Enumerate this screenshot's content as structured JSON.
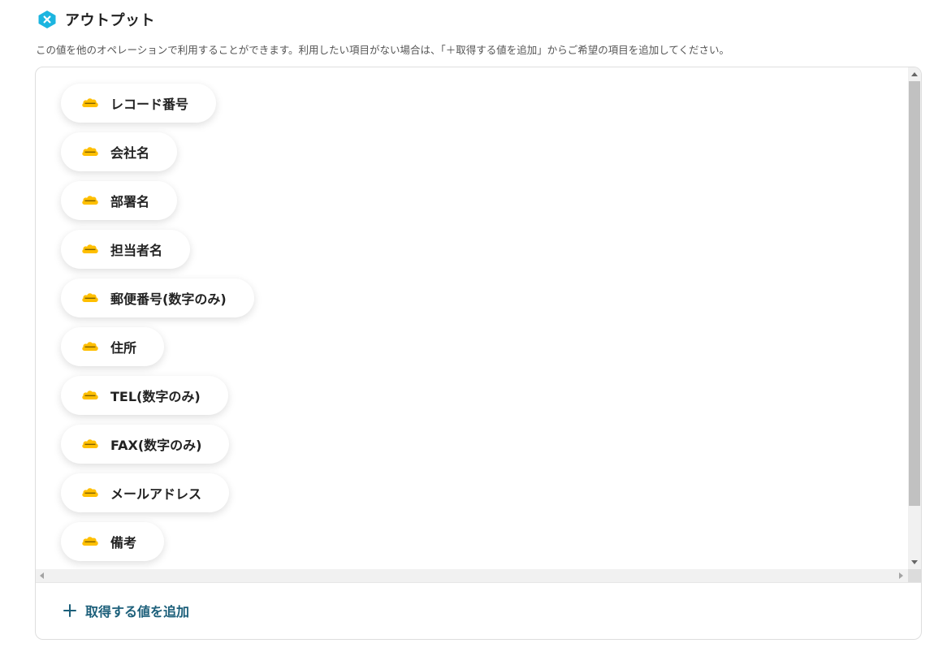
{
  "section": {
    "title": "アウトプット",
    "description": "この値を他のオペレーションで利用することができます。利用したい項目がない場合は、「＋取得する値を追加」からご希望の項目を追加してください。",
    "icon": "yoom-logo-icon",
    "accent_color": "#1cb5e0"
  },
  "outputs": {
    "chip_icon": "kintone-icon",
    "chip_icon_color": "#ffbf00",
    "items": [
      {
        "label": "レコード番号"
      },
      {
        "label": "会社名"
      },
      {
        "label": "部署名"
      },
      {
        "label": "担当者名"
      },
      {
        "label": "郵便番号(数字のみ)"
      },
      {
        "label": "住所"
      },
      {
        "label": "TEL(数字のみ)"
      },
      {
        "label": "FAX(数字のみ)"
      },
      {
        "label": "メールアドレス"
      },
      {
        "label": "備考"
      }
    ]
  },
  "footer": {
    "add_label": "取得する値を追加",
    "add_icon": "plus-icon",
    "add_color": "#1c5f7a"
  }
}
